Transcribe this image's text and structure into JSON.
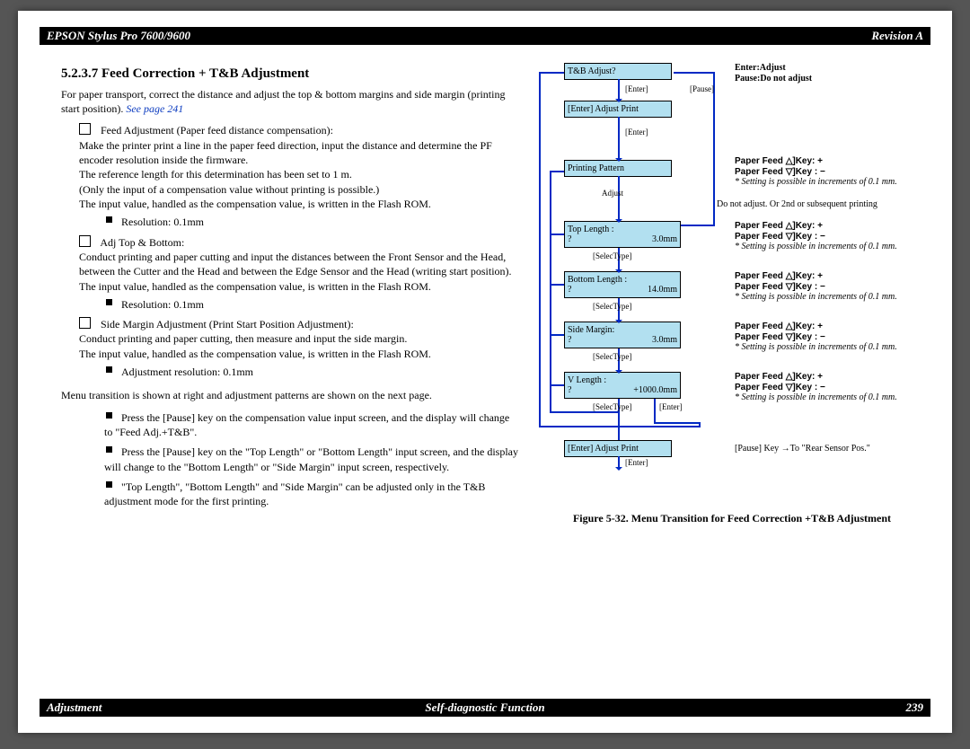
{
  "header": {
    "left": "EPSON Stylus Pro 7600/9600",
    "right": "Revision A"
  },
  "footer": {
    "left": "Adjustment",
    "center": "Self-diagnostic Function",
    "right": "239"
  },
  "title": "5.2.3.7  Feed Correction + T&B Adjustment",
  "intro": "For paper transport, correct the distance and adjust the top & bottom margins and side margin (printing start position). ",
  "seepage": "See page 241",
  "s1_head": "Feed Adjustment (Paper feed distance compensation):",
  "s1_p1": "Make the printer print a line in the paper feed direction, input the distance and determine the PF encoder resolution inside the firmware.",
  "s1_p2": "The reference length for this determination has been set to 1 m.",
  "s1_p3": "(Only the input of a compensation value without printing is possible.)",
  "s1_p4": "The input value, handled as the compensation value, is written in the Flash ROM.",
  "s1_res": "Resolution: 0.1mm",
  "s2_head": "Adj Top & Bottom:",
  "s2_p1": "Conduct printing and paper cutting and input the distances between the Front Sensor and the Head, between the Cutter and the Head and between the Edge Sensor and the Head (writing start position).",
  "s2_p2": "The input value, handled as the compensation value, is written in the Flash ROM.",
  "s2_res": "Resolution: 0.1mm",
  "s3_head": "Side Margin Adjustment (Print Start Position Adjustment):",
  "s3_p1": "Conduct printing and paper cutting, then measure and input the side margin.",
  "s3_p2": "The input value, handled as the compensation value, is written in the Flash ROM.",
  "s3_res": "Adjustment resolution: 0.1mm",
  "transition_note": "Menu transition is shown at right and adjustment patterns are shown on the next page.",
  "b1": "Press the [Pause] key on the compensation value input screen, and the display will change to \"Feed Adj.+T&B\".",
  "b2": "Press the [Pause] key on the \"Top Length\" or \"Bottom Length\" input screen, and the display will change to the \"Bottom Length\" or \"Side Margin\" input screen, respectively.",
  "b3": "\"Top Length\", \"Bottom Length\" and \"Side Margin\" can be adjusted only in the T&B adjustment mode for the first printing.",
  "fig_caption": "Figure 5-32.  Menu Transition for Feed Correction +T&B Adjustment",
  "flow": {
    "b0": "T&B Adjust?",
    "b1": "[Enter] Adjust Print",
    "b2": "Printing Pattern",
    "b3_l1": "Top Length :",
    "b3_l2a": "?",
    "b3_l2b": "3.0mm",
    "b4_l1": "Bottom Length :",
    "b4_l2a": "?",
    "b4_l2b": "14.0mm",
    "b5_l1": "Side Margin:",
    "b5_l2a": "?",
    "b5_l2b": "3.0mm",
    "b6_l1": "V Length :",
    "b6_l2a": "?",
    "b6_l2b": "+1000.0mm",
    "b7": "[Enter] Adjust Print",
    "lbl_enter": "[Enter]",
    "lbl_pause": "[Pause]",
    "lbl_adjust": "Adjust",
    "lbl_selectype": "[SelecType]",
    "r0a": "Enter:Adjust",
    "r0b": "Pause:Do not adjust",
    "r_key_up": "Paper Feed △]Key: +",
    "r_key_dn": "Paper Feed ▽]Key : −",
    "r_note": "* Setting is possible in increments of 0.1 mm.",
    "r_mid": "Do not adjust. Or 2nd or subsequent printing",
    "r_last": "[Pause] Key →To \"Rear Sensor Pos.\""
  }
}
